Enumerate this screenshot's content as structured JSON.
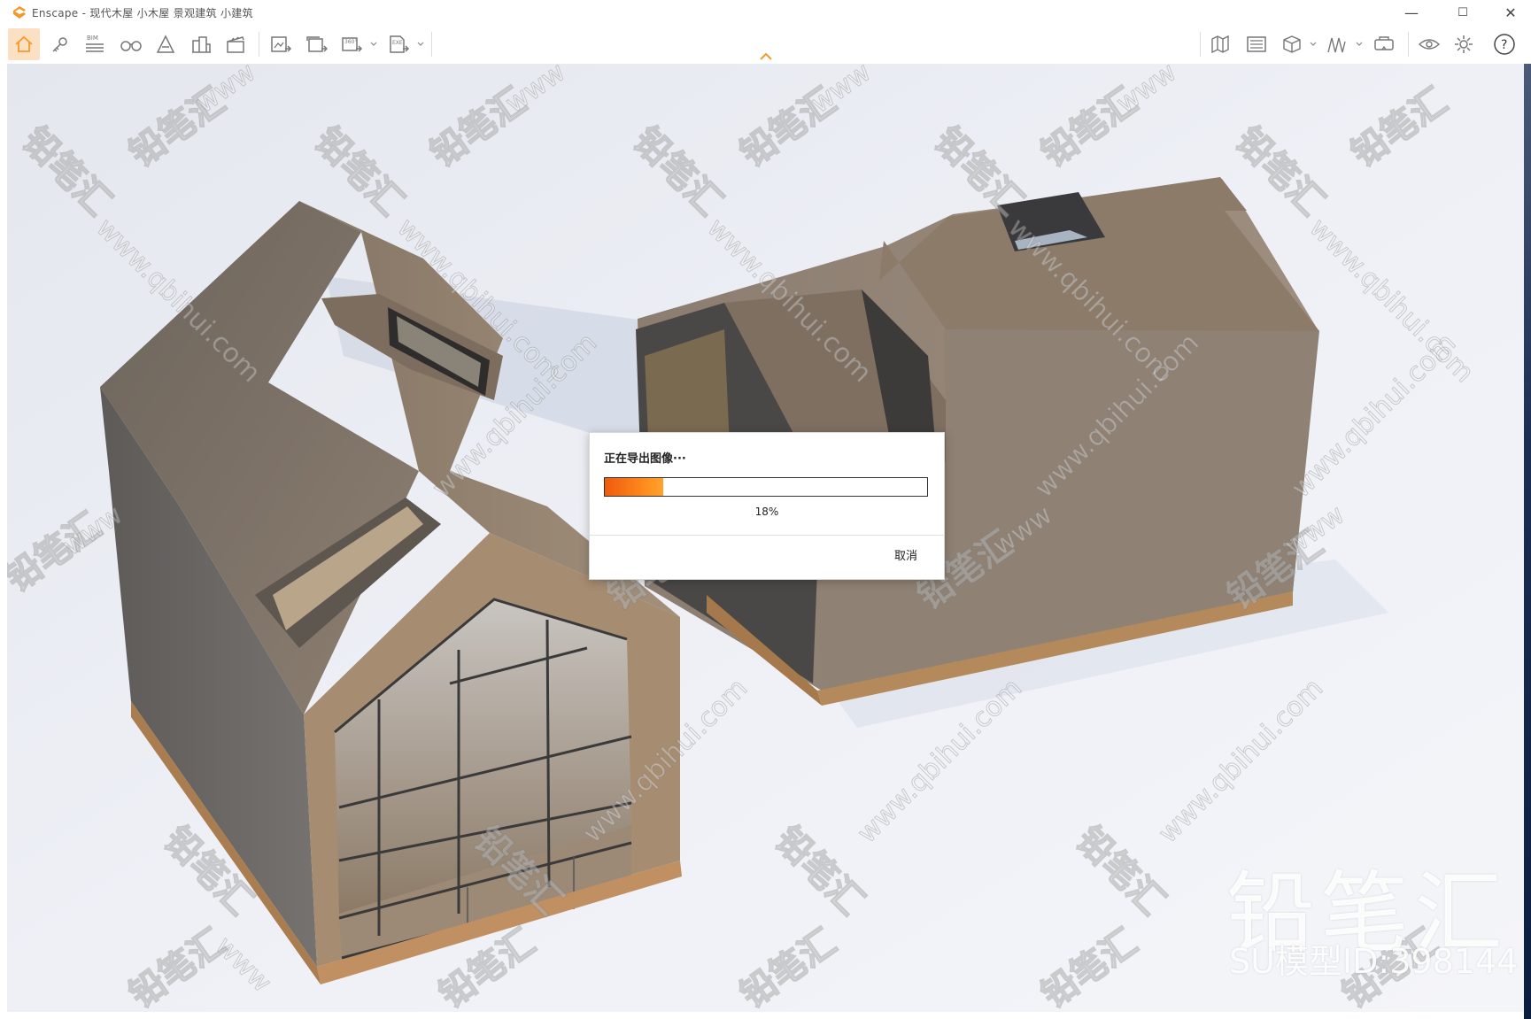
{
  "window": {
    "title": "Enscape - 现代木屋 小木屋 景观建筑 小建筑",
    "controls": {
      "minimize": "—",
      "maximize": "☐",
      "close": "✕"
    }
  },
  "toolbar": {
    "left_icons": [
      "home-icon",
      "key-icon",
      "bim-icon",
      "binoculars-icon",
      "atmosphere-icon",
      "buildings-icon",
      "clapper-icon",
      "render-screenshot-icon",
      "batch-render-icon",
      "panorama-360-icon",
      "export-exe-icon"
    ],
    "right_icons": [
      "map-icon",
      "gallery-icon",
      "material-cube-icon",
      "asset-library-icon",
      "vr-headset-icon",
      "visibility-icon",
      "settings-gear-icon",
      "help-icon"
    ],
    "bim_label": "BIM",
    "pano_label": "360°",
    "exe_label": "EXE",
    "help_label": "?"
  },
  "dialog": {
    "title": "正在导出图像···",
    "progress_fraction": 0.18,
    "progress_text": "18%",
    "cancel_label": "取消"
  },
  "watermark": {
    "brand_cn": "铅笔汇",
    "site": "www.qbihui.com",
    "model_id": "SU模型ID:398144"
  },
  "colors": {
    "accent": "#f39a2a",
    "progress_start": "#ef5a0e",
    "progress_end": "#ffa32c",
    "active_tab_bg": "#fbe0c3"
  }
}
